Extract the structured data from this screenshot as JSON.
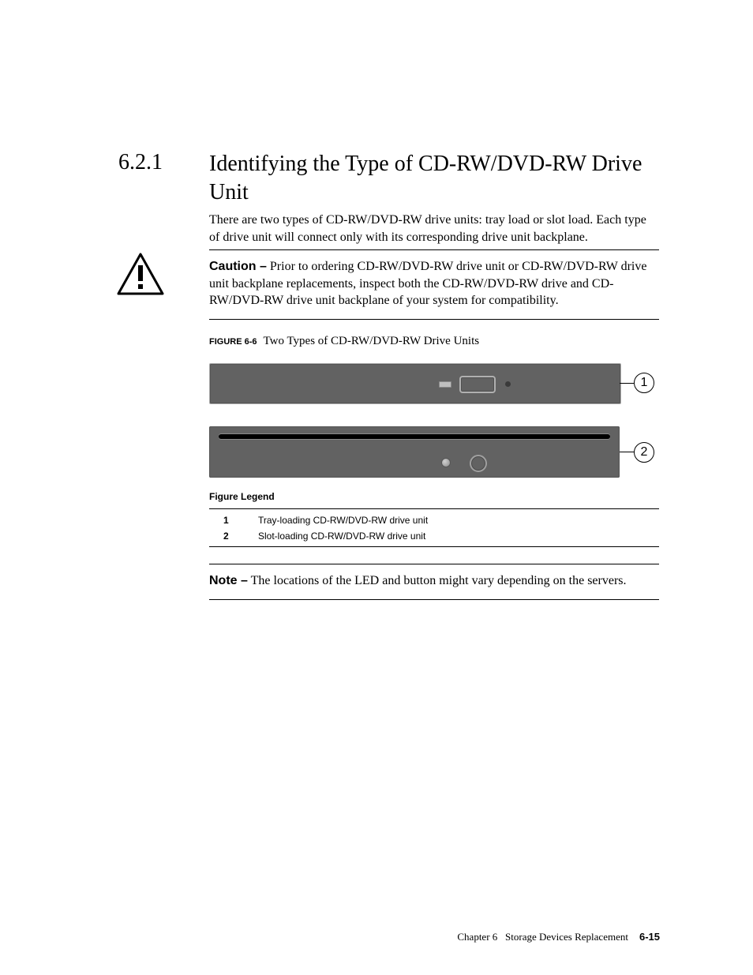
{
  "section": {
    "number": "6.2.1",
    "title": "Identifying the Type of CD-RW/DVD-RW Drive Unit"
  },
  "intro": "There are two types of CD-RW/DVD-RW drive units: tray load or slot load. Each type of drive unit will connect only with its corresponding drive unit backplane.",
  "caution": {
    "label": "Caution –",
    "text": " Prior to ordering CD-RW/DVD-RW drive unit or CD-RW/DVD-RW drive unit backplane replacements, inspect both the CD-RW/DVD-RW drive and CD-RW/DVD-RW drive unit backplane of your system for compatibility."
  },
  "figure": {
    "label": "FIGURE 6-6",
    "title": "Two Types of CD-RW/DVD-RW Drive Units",
    "callouts": {
      "c1": "1",
      "c2": "2"
    }
  },
  "legend": {
    "heading": "Figure Legend",
    "rows": [
      {
        "num": "1",
        "text": "Tray-loading CD-RW/DVD-RW drive unit"
      },
      {
        "num": "2",
        "text": "Slot-loading CD-RW/DVD-RW drive unit"
      }
    ]
  },
  "note": {
    "label": "Note –",
    "text": " The locations of the LED and button might vary depending on the servers."
  },
  "footer": {
    "chapter": "Chapter 6",
    "title": "Storage Devices Replacement",
    "page": "6-15"
  }
}
